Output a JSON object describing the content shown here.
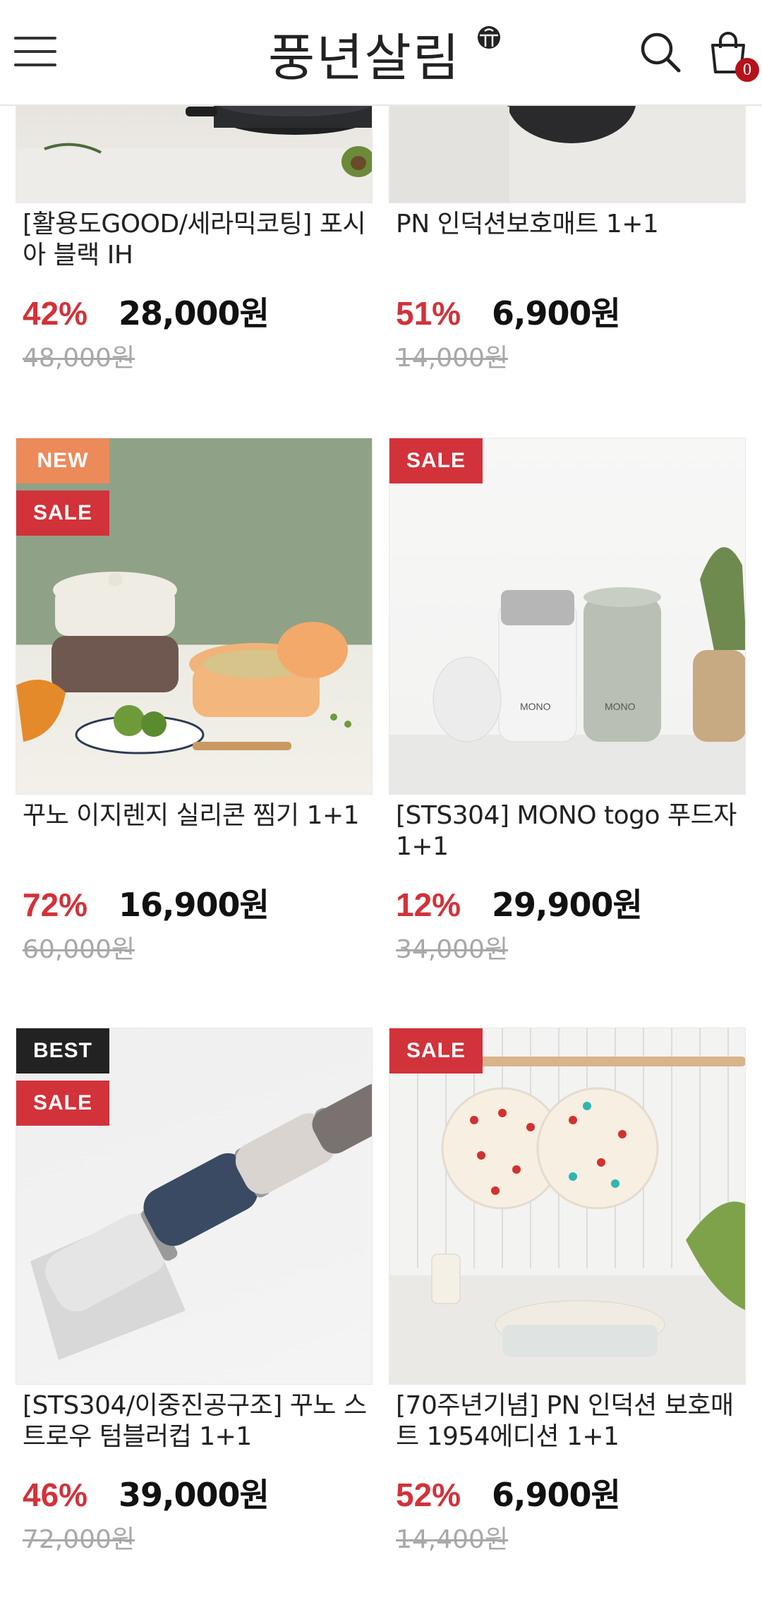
{
  "header": {
    "logo_text": "풍년살림",
    "cart_count": "0"
  },
  "products": [
    {
      "title": "[활용도GOOD/세라믹코팅] 포시아 블랙 IH",
      "discount": "42%",
      "price": "28,000원",
      "original_price": "48,000원",
      "badges": []
    },
    {
      "title": "PN 인덕션보호매트 1+1",
      "discount": "51%",
      "price": "6,900원",
      "original_price": "14,000원",
      "badges": []
    },
    {
      "title": "꾸노 이지렌지 실리콘 찜기 1+1",
      "discount": "72%",
      "price": "16,900원",
      "original_price": "60,000원",
      "badges": [
        "NEW",
        "SALE"
      ]
    },
    {
      "title": "[STS304] MONO togo 푸드자 1+1",
      "discount": "12%",
      "price": "29,900원",
      "original_price": "34,000원",
      "badges": [
        "SALE"
      ]
    },
    {
      "title": "[STS304/이중진공구조] 꾸노 스트로우 텀블러컵 1+1",
      "discount": "46%",
      "price": "39,000원",
      "original_price": "72,000원",
      "badges": [
        "BEST",
        "SALE"
      ]
    },
    {
      "title": "[70주년기념] PN 인덕션 보호매트 1954에디션 1+1",
      "discount": "52%",
      "price": "6,900원",
      "original_price": "14,400원",
      "badges": [
        "SALE"
      ]
    }
  ]
}
